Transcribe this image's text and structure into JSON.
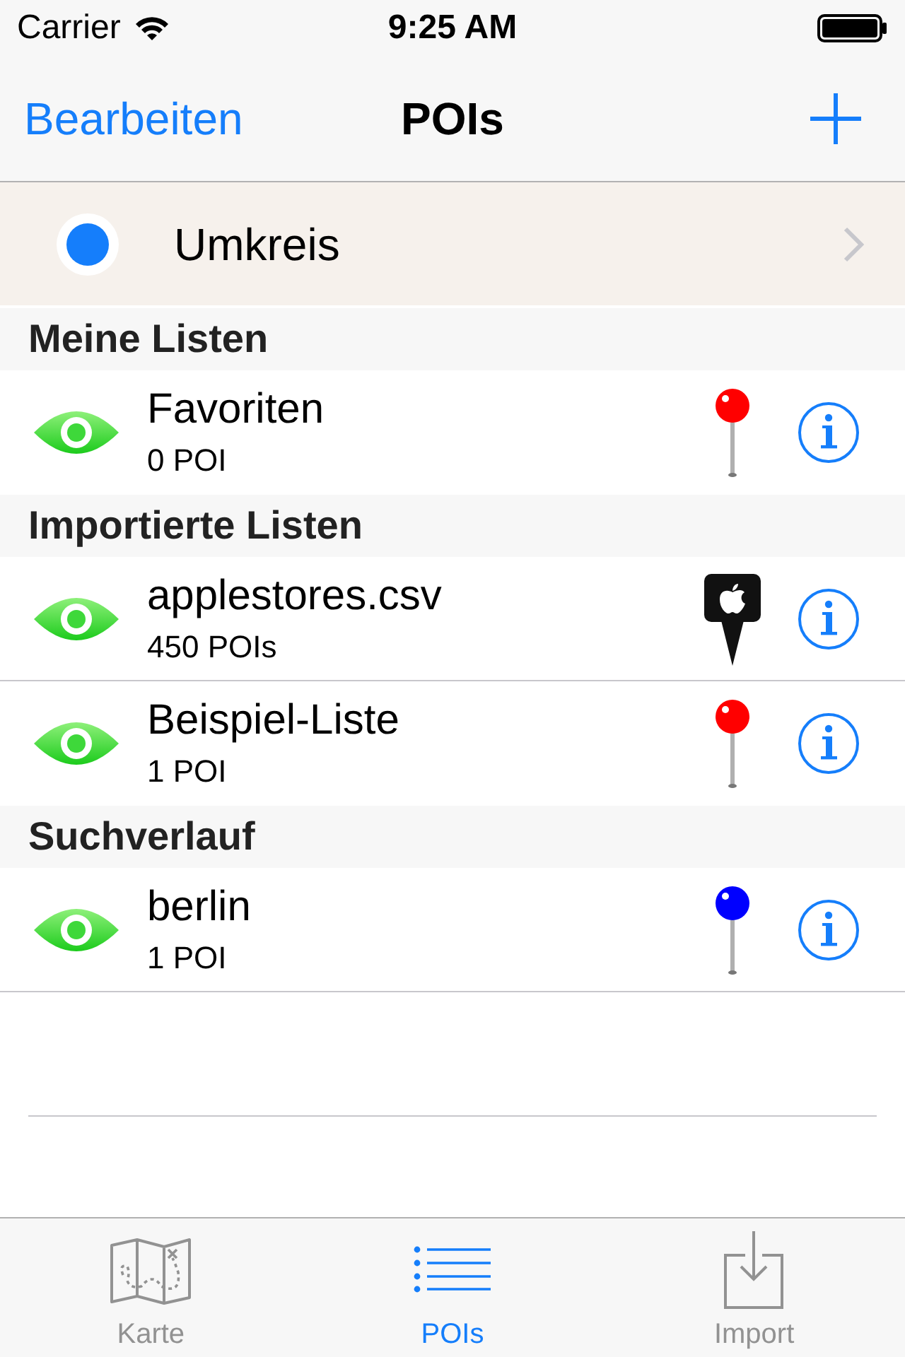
{
  "status_bar": {
    "carrier": "Carrier",
    "time": "9:25 AM"
  },
  "nav_bar": {
    "left_button": "Bearbeiten",
    "title": "POIs"
  },
  "radius_row": {
    "label": "Umkreis"
  },
  "sections": [
    {
      "header": "Meine Listen",
      "items": [
        {
          "title": "Favoriten",
          "subtitle": "0 POI",
          "marker": {
            "kind": "ball",
            "color": "#ff0000"
          }
        }
      ]
    },
    {
      "header": "Importierte Listen",
      "items": [
        {
          "title": "applestores.csv",
          "subtitle": "450 POIs",
          "marker": {
            "kind": "logo"
          }
        },
        {
          "title": "Beispiel-Liste",
          "subtitle": "1 POI",
          "marker": {
            "kind": "ball",
            "color": "#ff0000"
          }
        }
      ]
    },
    {
      "header": "Suchverlauf",
      "items": [
        {
          "title": "berlin",
          "subtitle": "1 POI",
          "marker": {
            "kind": "ball",
            "color": "#0000ff"
          }
        }
      ]
    }
  ],
  "tab_bar": {
    "tabs": [
      {
        "label": "Karte",
        "selected": false
      },
      {
        "label": "POIs",
        "selected": true
      },
      {
        "label": "Import",
        "selected": false
      }
    ]
  }
}
